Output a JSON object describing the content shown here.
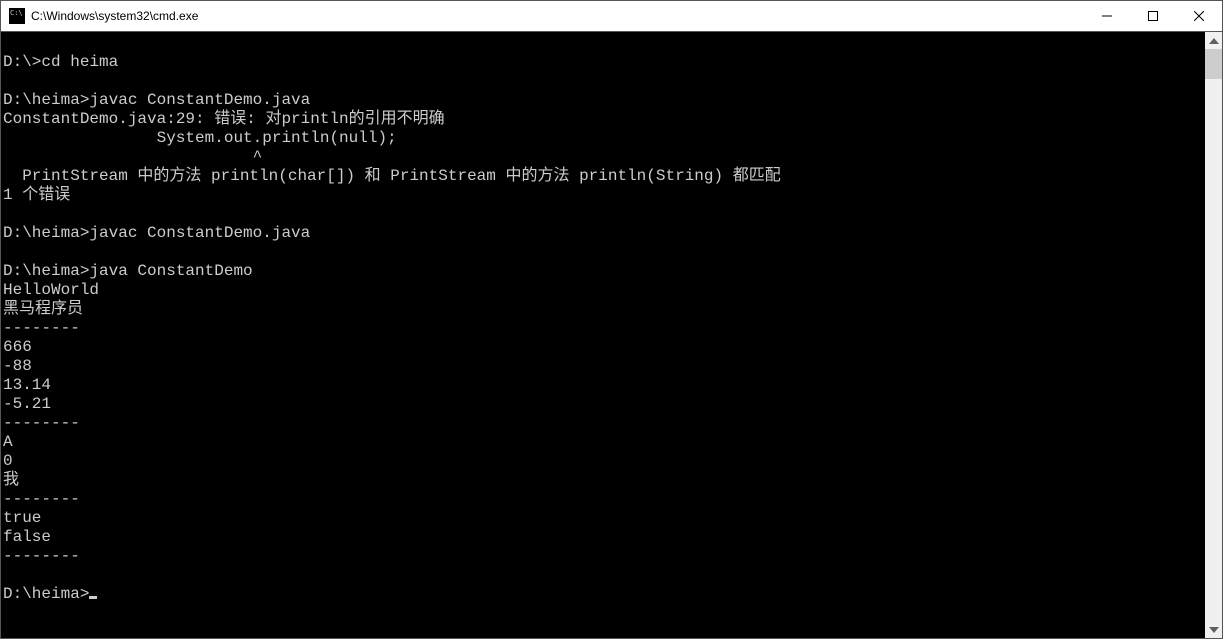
{
  "window": {
    "title": "C:\\Windows\\system32\\cmd.exe"
  },
  "terminal": {
    "lines": [
      "",
      "D:\\>cd heima",
      "",
      "D:\\heima>javac ConstantDemo.java",
      "ConstantDemo.java:29: 错误: 对println的引用不明确",
      "                System.out.println(null);",
      "                          ^",
      "  PrintStream 中的方法 println(char[]) 和 PrintStream 中的方法 println(String) 都匹配",
      "1 个错误",
      "",
      "D:\\heima>javac ConstantDemo.java",
      "",
      "D:\\heima>java ConstantDemo",
      "HelloWorld",
      "黑马程序员",
      "--------",
      "666",
      "-88",
      "13.14",
      "-5.21",
      "--------",
      "A",
      "0",
      "我",
      "--------",
      "true",
      "false",
      "--------",
      "",
      "D:\\heima>"
    ]
  }
}
